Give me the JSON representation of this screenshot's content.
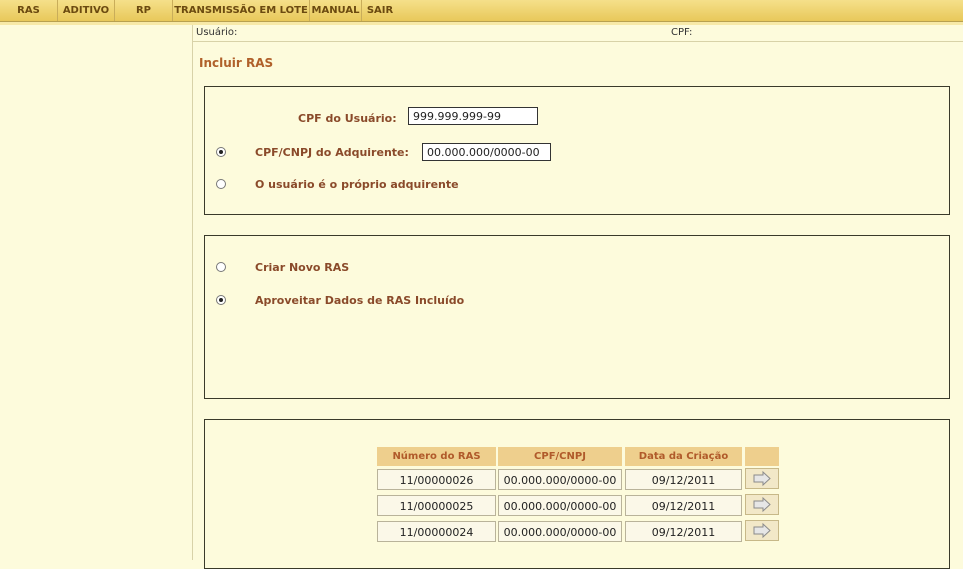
{
  "menu": {
    "items": [
      "RAS",
      "ADITIVO",
      "RP",
      "TRANSMISSÃO EM LOTE",
      "MANUAL",
      "SAIR"
    ]
  },
  "userbar": {
    "usuario_label": "Usuário:",
    "cpf_label": "CPF:"
  },
  "page_title": "Incluir RAS",
  "form": {
    "cpf_usuario_label": "CPF do Usuário:",
    "cpf_usuario_value": "999.999.999-99",
    "cpf_cnpj_adquirente_label": "CPF/CNPJ do Adquirente:",
    "cpf_cnpj_adquirente_value": "00.000.000/0000-00",
    "proprio_adquirente_label": "O usuário é o próprio adquirente",
    "selected_adquirente_option": "CPF/CNPJ do Adquirente"
  },
  "ras_options": {
    "criar_novo_label": "Criar Novo RAS",
    "aproveitar_label": "Aproveitar Dados de RAS Incluído",
    "selected": "Aproveitar Dados de RAS Incluído"
  },
  "table": {
    "headers": [
      "Número do RAS",
      "CPF/CNPJ",
      "Data da Criação"
    ],
    "rows": [
      {
        "numero": "11/00000026",
        "cpf_cnpj": "00.000.000/0000-00",
        "data": "09/12/2011"
      },
      {
        "numero": "11/00000025",
        "cpf_cnpj": "00.000.000/0000-00",
        "data": "09/12/2011"
      },
      {
        "numero": "11/00000024",
        "cpf_cnpj": "00.000.000/0000-00",
        "data": "09/12/2011"
      }
    ]
  },
  "colors": {
    "background": "#fdfbdc",
    "menubar": "#e8c85a",
    "label_text": "#8a4a2a",
    "title_text": "#b0602a",
    "table_header": "#eecf8d"
  }
}
